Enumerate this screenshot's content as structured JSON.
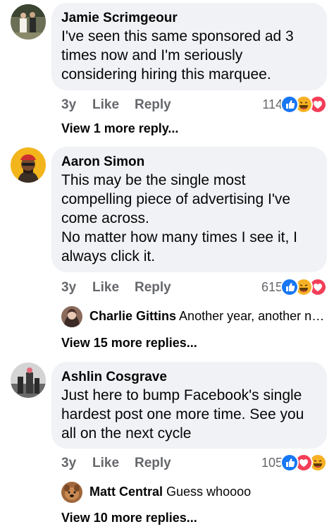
{
  "comments": [
    {
      "name": "Jamie Scrimgeour",
      "text": "I've seen this same sponsored ad 3 times now and I'm seriously considering hiring this marquee.",
      "time": "3y",
      "like": "Like",
      "reply": "Reply",
      "reaction_count": "114",
      "reactions": [
        "like-icon",
        "haha-icon",
        "love-icon"
      ],
      "more_replies": "View 1 more reply..."
    },
    {
      "name": "Aaron Simon",
      "text": "This may be the single most compelling piece of advertising I've come across.\nNo matter how many times I see it, I always click it.",
      "time": "3y",
      "like": "Like",
      "reply": "Reply",
      "reaction_count": "615",
      "reactions": [
        "like-icon",
        "haha-icon",
        "love-icon"
      ],
      "reply_preview": {
        "name": "Charlie Gittins",
        "text": "Another year, another no..."
      },
      "more_replies": "View 15 more replies..."
    },
    {
      "name": "Ashlin Cosgrave",
      "text": "Just here to bump Facebook's single hardest post one more time. See you all on the next cycle",
      "time": "3y",
      "like": "Like",
      "reply": "Reply",
      "reaction_count": "105",
      "reactions": [
        "like-icon",
        "love-icon",
        "haha-icon"
      ],
      "reply_preview": {
        "name": "Matt Central",
        "text": "Guess whoooo"
      },
      "more_replies": "View 10 more replies..."
    }
  ],
  "colors": {
    "bubble": "#f0f2f5",
    "meta": "#65676b",
    "like": "#1877f2",
    "love": "#f33e58",
    "haha": "#f7b125"
  }
}
